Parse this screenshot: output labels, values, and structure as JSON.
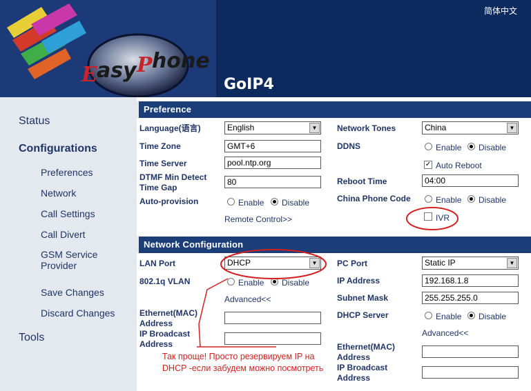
{
  "header": {
    "brand": "EasyPhone",
    "product": "GoIP4",
    "language_link": "简体中文"
  },
  "sidebar": {
    "status": "Status",
    "configurations": "Configurations",
    "items": [
      "Preferences",
      "Network",
      "Call Settings",
      "Call Divert",
      "GSM Service Provider"
    ],
    "save": "Save Changes",
    "discard": "Discard Changes",
    "tools": "Tools"
  },
  "preference": {
    "title": "Preference",
    "language_label": "Language(语言)",
    "language_value": "English",
    "timezone_label": "Time Zone",
    "timezone_value": "GMT+6",
    "timeserver_label": "Time Server",
    "timeserver_value": "pool.ntp.org",
    "dtmf_label_1": "DTMF Min Detect",
    "dtmf_label_2": "Time Gap",
    "dtmf_value": "80",
    "autoprov_label": "Auto-provision",
    "enable": "Enable",
    "disable": "Disable",
    "remote_control": "Remote Control>>",
    "tones_label": "Network Tones",
    "tones_value": "China",
    "ddns_label": "DDNS",
    "auto_reboot": "Auto Reboot",
    "reboot_label": "Reboot Time",
    "reboot_value": "04:00",
    "china_code_label": "China Phone Code",
    "ivr": "IVR"
  },
  "network": {
    "title": "Network Configuration",
    "lan_label": "LAN Port",
    "lan_value": "DHCP",
    "vlan_label": "802.1q VLAN",
    "enable": "Enable",
    "disable": "Disable",
    "advanced": "Advanced<<",
    "eth_mac_1": "Ethernet(MAC)",
    "eth_mac_2": "Address",
    "ip_bcast_1": "IP Broadcast",
    "ip_bcast_2": "Address",
    "pc_label": "PC Port",
    "pc_value": "Static IP",
    "ip_label": "IP Address",
    "ip_value": "192.168.1.8",
    "mask_label": "Subnet Mask",
    "mask_value": "255.255.255.0",
    "dhcp_label": "DHCP Server",
    "advanced2": "Advanced<<"
  },
  "annotation": {
    "text": "Так проще! Просто резервируем IP на DHCP -если забудем можно посмотреть",
    "color": "#d42020"
  }
}
